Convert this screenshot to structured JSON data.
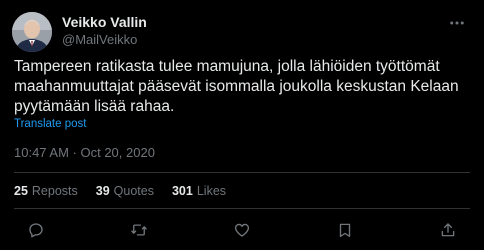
{
  "author": {
    "display_name": "Veikko Vallin",
    "handle": "@MailVeikko",
    "avatar_icon": "profile-photo"
  },
  "post": {
    "text": "Tampereen ratikasta tulee mamujuna, jolla lähiöiden työttömät\nmaahanmuuttajat pääsevät isommalla joukolla keskustan Kelaan\npyytämään lisää rahaa.",
    "translate_label": "Translate post",
    "timestamp": "10:47 AM · Oct 20, 2020"
  },
  "stats": {
    "reposts_count": "25",
    "reposts_label": "Reposts",
    "quotes_count": "39",
    "quotes_label": "Quotes",
    "likes_count": "301",
    "likes_label": "Likes"
  },
  "actions": [
    "reply-icon",
    "repost-icon",
    "like-icon",
    "bookmark-icon",
    "share-icon"
  ],
  "colors": {
    "background": "#000000",
    "text_primary": "#e7e9ea",
    "text_secondary": "#71767b",
    "link": "#1d9bf0",
    "divider": "#2f3336"
  }
}
